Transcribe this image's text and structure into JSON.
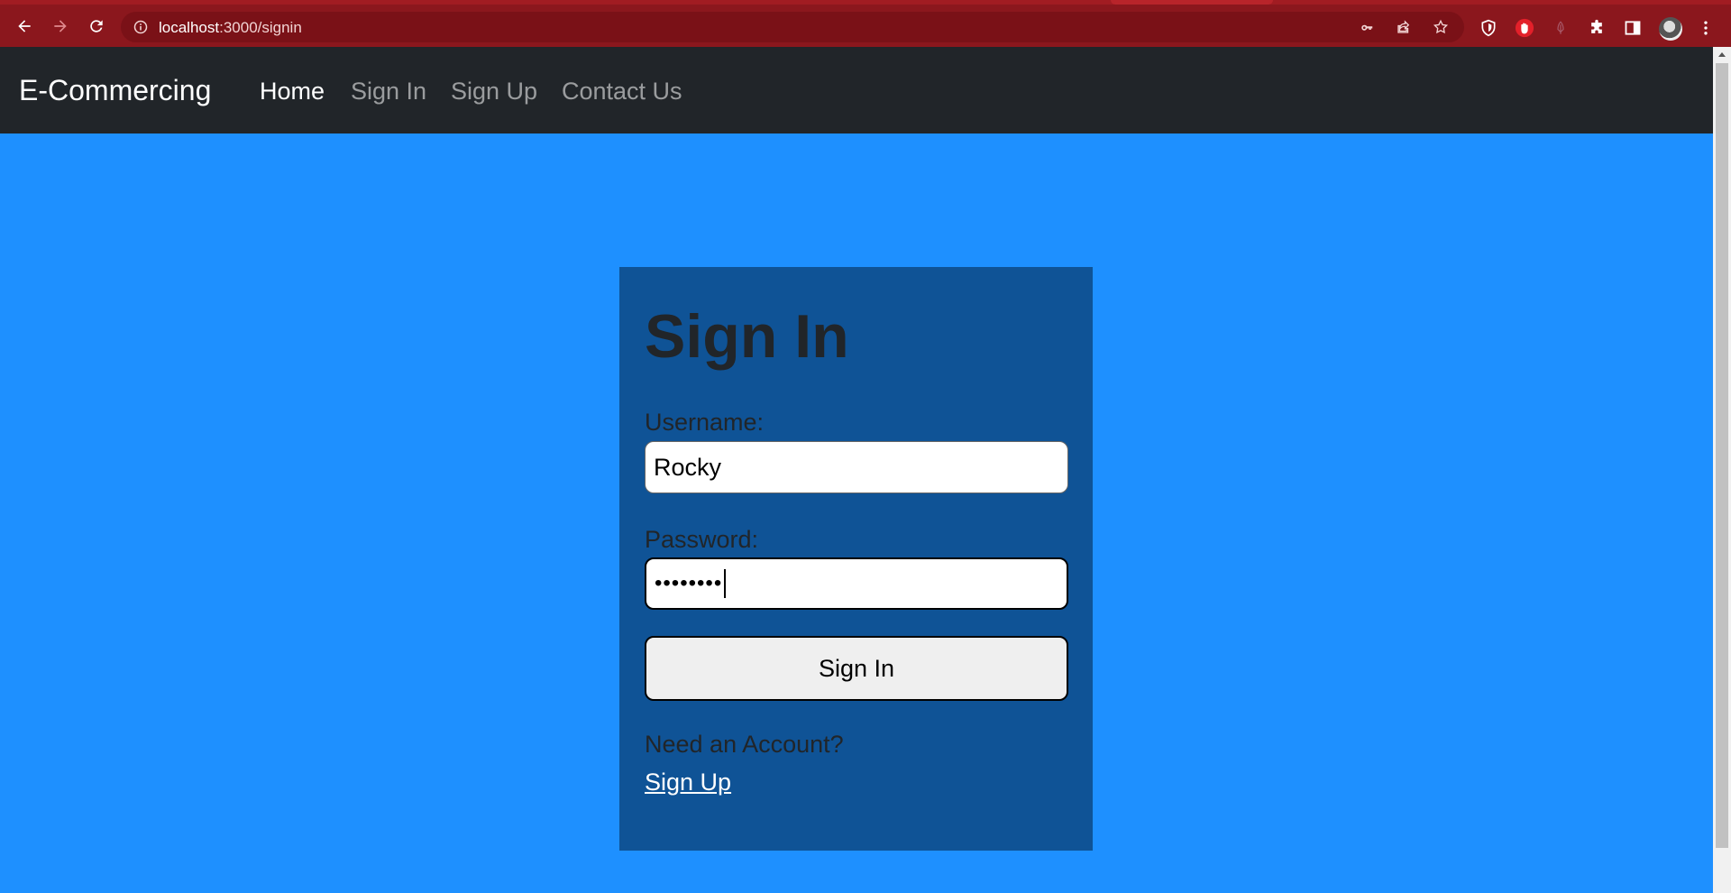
{
  "browser": {
    "url_host": "localhost",
    "url_path": ":3000/signin"
  },
  "navbar": {
    "brand": "E-Commercing",
    "links": [
      {
        "label": "Home",
        "active": true
      },
      {
        "label": "Sign In",
        "active": false
      },
      {
        "label": "Sign Up",
        "active": false
      },
      {
        "label": "Contact Us",
        "active": false
      }
    ]
  },
  "form": {
    "title": "Sign In",
    "username_label": "Username:",
    "username_value": "Rocky",
    "password_label": "Password:",
    "password_mask": "••••••••",
    "submit_label": "Sign In",
    "need_account": "Need an Account?",
    "signup_link": "Sign Up"
  },
  "colors": {
    "page_bg": "#1e90ff",
    "card_bg": "#0f5396",
    "navbar_bg": "#212529",
    "browser_frame": "#8b171d"
  },
  "icons": [
    "back-arrow-icon",
    "forward-arrow-icon",
    "reload-icon",
    "info-icon",
    "key-icon",
    "share-icon",
    "star-icon",
    "brave-shield-icon",
    "hand-stop-icon",
    "feather-icon",
    "puzzle-icon",
    "sidebar-icon",
    "menu-dots-icon"
  ]
}
